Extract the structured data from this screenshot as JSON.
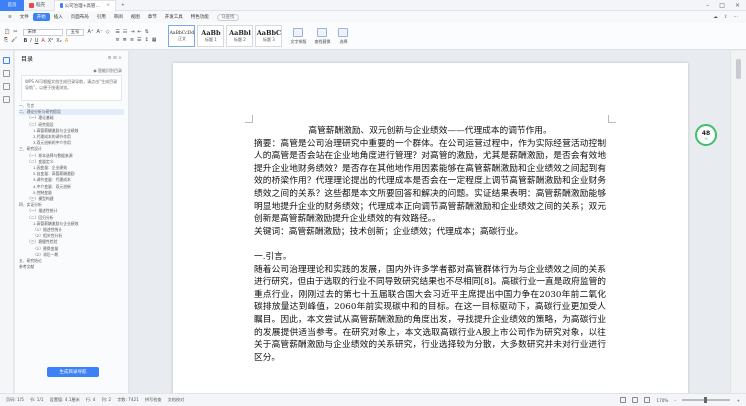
{
  "tabs": [
    {
      "label": "首页"
    },
    {
      "label": "稻壳"
    },
    {
      "label": "公司治理+高管激励…2019BD10(1)"
    }
  ],
  "menu": {
    "items": [
      "文件",
      "开始",
      "插入",
      "页面布局",
      "引用",
      "审阅",
      "视图",
      "章节",
      "开发工具",
      "特色功能"
    ],
    "active_index": 1,
    "search": "Q查找"
  },
  "ribbon": {
    "font_name": "宋体",
    "font_size": "五号",
    "styles": [
      {
        "sample": "AaBbCcDd",
        "name": "正文"
      },
      {
        "sample": "AaBb",
        "name": "标题 1"
      },
      {
        "sample": "AaBbl",
        "name": "标题 2"
      },
      {
        "sample": "AaBbC",
        "name": "标题 3"
      }
    ],
    "btn_format": "文字排版",
    "btn_find": "查找替换",
    "btn_select": "选择"
  },
  "toc": {
    "title": "目录",
    "smart": "智能识别目录",
    "wps_note": "WPS AI可根据文档生成目录导航，请点击“生成目录导航”，以便于快速浏览。",
    "items": [
      {
        "level": 1,
        "text": "一、引言"
      },
      {
        "level": 1,
        "text": "二、理论分析与研究假设",
        "sel": true
      },
      {
        "level": 2,
        "text": "（一）理论基础"
      },
      {
        "level": 2,
        "text": "（二）研究假设"
      },
      {
        "level": 3,
        "text": "1.高管薪酬激励与企业绩效"
      },
      {
        "level": 3,
        "text": "2.代理成本的调节作用"
      },
      {
        "level": 3,
        "text": "3.双元创新的中介作用"
      },
      {
        "level": 1,
        "text": "三、研究设计"
      },
      {
        "level": 2,
        "text": "（一）样本选择与数据来源"
      },
      {
        "level": 2,
        "text": "（二）变量定义"
      },
      {
        "level": 3,
        "text": "1.因变量：企业绩效"
      },
      {
        "level": 3,
        "text": "2.自变量：高管薪酬激励"
      },
      {
        "level": 3,
        "text": "3.调节变量：代理成本"
      },
      {
        "level": 3,
        "text": "4.中介变量：双元创新"
      },
      {
        "level": 3,
        "text": "5.控制变量"
      },
      {
        "level": 2,
        "text": "（三）模型构建"
      },
      {
        "level": 1,
        "text": "四、实证分析"
      },
      {
        "level": 2,
        "text": "（一）描述性统计"
      },
      {
        "level": 2,
        "text": "（二）回归分析"
      },
      {
        "level": 3,
        "text": "1.高管薪酬激励与企业绩效"
      },
      {
        "level": 3,
        "text": "（1）描述性统计"
      },
      {
        "level": 3,
        "text": "（2）相关性分析"
      },
      {
        "level": 2,
        "text": "（三）稳健性检验"
      },
      {
        "level": 3,
        "text": "（1）替换变量"
      },
      {
        "level": 3,
        "text": "（2）滞后一期"
      },
      {
        "level": 1,
        "text": "五、研究结论"
      },
      {
        "level": 1,
        "text": "参考文献"
      }
    ],
    "generate_button": "生成目录导航"
  },
  "doc": {
    "title": "高管薪酬激励、双元创新与企业绩效——代理成本的调节作用。",
    "abstract": "摘要：高管是公司治理研究中重要的一个群体。在公司运营过程中，作为实际经营活动控制人的高管是否会站在企业地角度进行管理？对高管的激励，尤其是薪酬激励，是否会有效地提升企业地财务绩效？是否存在其他地作用因素能够在高管薪酬激励和企业绩效之间起到有效的桥梁作用？代理理论提出的代理成本是否会在一定程度上调节高管薪酬激励和企业财务绩效之间的关系？这些都是本文所要回答和解决的问题。实证结果表明：高管薪酬激励能够明显地提升企业的财务绩效；代理成本正向调节高管薪酬激励和企业绩效之间的关系；双元创新是高管薪酬激励提升企业绩效的有效路径。。",
    "keywords": "关键词：高管薪酬激励；技术创新；企业绩效；代理成本；高碳行业。",
    "section1": "一.引言。",
    "intro": "随着公司治理理论和实践的发展，国内外许多学者都对高管群体行为与企业绩效之间的关系进行研究，但由于选取的行业不同导致研究结果也不尽相同[8]。高碳行业一直是政府监管的重点行业，刚刚过去的第七十五届联合国大会习近平主席提出中国力争在2030年前二氧化碳排放量达到峰值，2060年前实现碳中和的目标。在这一目标驱动下，高碳行业更加受人瞩目。因此，本文尝试从高管薪酬激励的角度出发，寻找提升企业绩效的策略，为高碳行业的发展提供适当参考。在研究对象上，本文选取高碳行业A股上市公司作为研究对象，以往关于高管薪酬激励与企业绩效的关系研究，行业选择较为分散，大多数研究并未对行业进行区分。"
  },
  "zoom_badge": {
    "value": "48",
    "unit": "%"
  },
  "status": {
    "left": [
      "页码: 1/5",
      "节: 1/1",
      "设置值: 4.1厘米",
      "行: 4",
      "列: 2",
      "字数: 7421",
      "拼写检查",
      "文档校对"
    ],
    "zoom": "170%"
  }
}
